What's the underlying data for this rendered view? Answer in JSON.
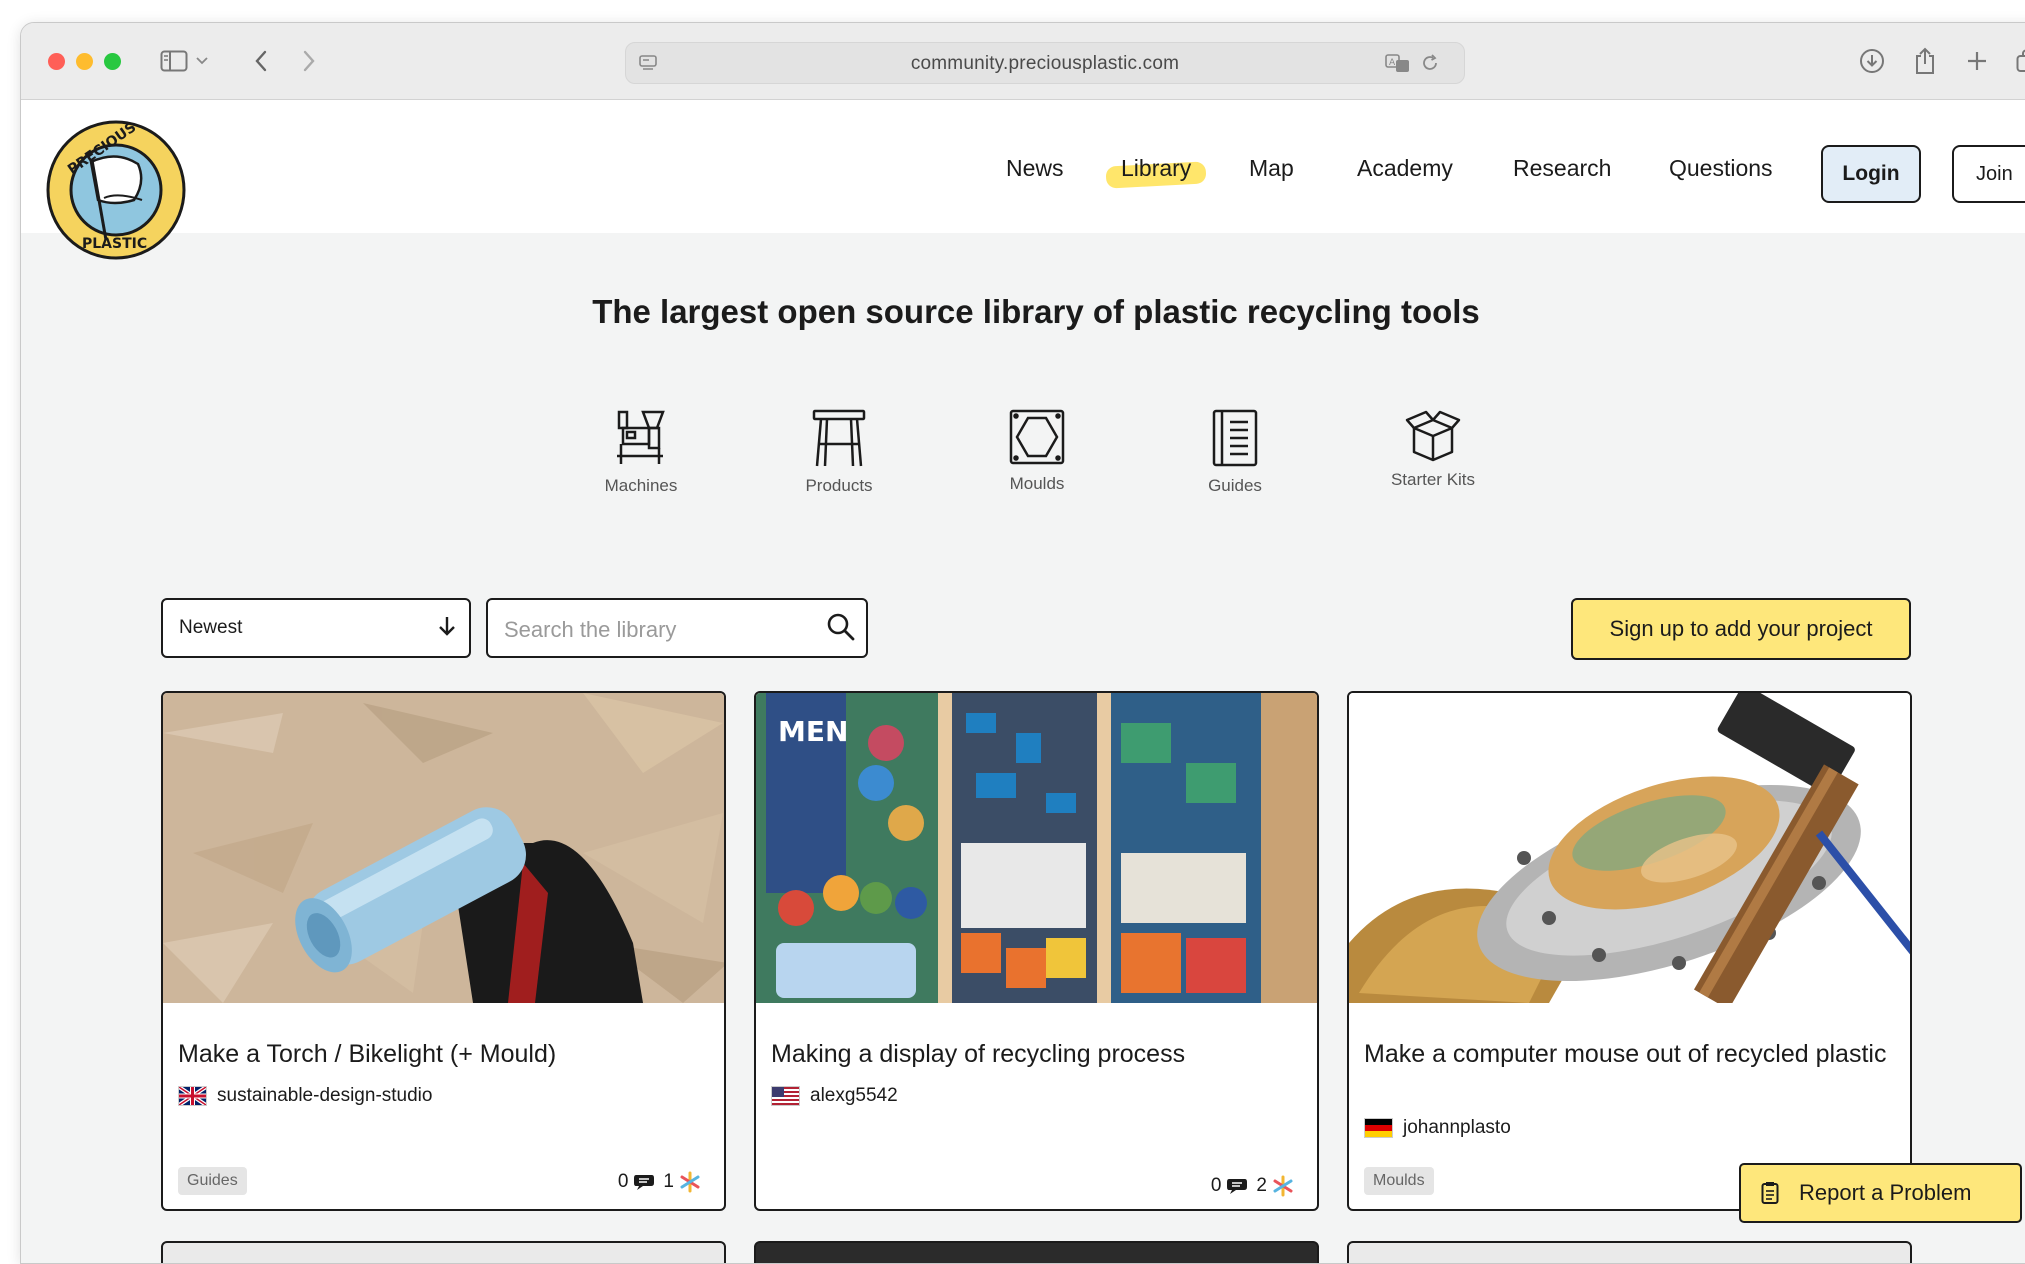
{
  "browser": {
    "url": "community.preciousplastic.com"
  },
  "nav": {
    "items": [
      {
        "label": "News"
      },
      {
        "label": "Library"
      },
      {
        "label": "Map"
      },
      {
        "label": "Academy"
      },
      {
        "label": "Research"
      },
      {
        "label": "Questions"
      }
    ],
    "active": "Library",
    "login": "Login",
    "join": "Join"
  },
  "hero": {
    "title": "The largest open source library of plastic recycling tools"
  },
  "categories": [
    {
      "label": "Machines",
      "icon": "machines-icon"
    },
    {
      "label": "Products",
      "icon": "products-stool-icon"
    },
    {
      "label": "Moulds",
      "icon": "moulds-icon"
    },
    {
      "label": "Guides",
      "icon": "guides-notebook-icon"
    },
    {
      "label": "Starter Kits",
      "icon": "starter-kits-box-icon"
    }
  ],
  "filters": {
    "sort_value": "Newest",
    "search_placeholder": "Search the library",
    "signup_cta": "Sign up to add your project"
  },
  "cards": [
    {
      "title": "Make a Torch / Bikelight (+ Mould)",
      "author": "sustainable-design-studio",
      "flag": "uk-flag-icon",
      "tag": "Guides",
      "comments": "0",
      "useful": "1"
    },
    {
      "title": "Making a display of recycling process",
      "author": "alexg5542",
      "flag": "us-flag-icon",
      "tag": "",
      "comments": "0",
      "useful": "2"
    },
    {
      "title": "Make a computer mouse out of recycled plastic",
      "author": "johannplasto",
      "flag": "de-flag-icon",
      "tag": "Moulds",
      "comments": "",
      "useful": ""
    }
  ],
  "report": {
    "label": "Report a Problem"
  },
  "colors": {
    "accent_yellow": "#fee77b",
    "login_bg": "#e2edf7",
    "text": "#1b1b1b",
    "page_bg": "#f3f4f4"
  }
}
